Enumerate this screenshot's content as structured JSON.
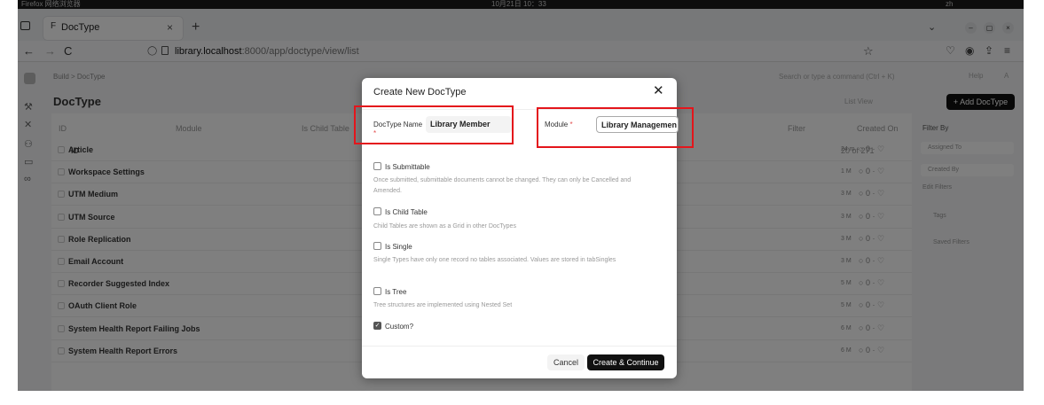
{
  "os": {
    "left_text": "Firefox 网络浏览器",
    "clock": "10月21日 10：33",
    "right_text": "zh"
  },
  "browser": {
    "tab_title": "DocType",
    "tab_close": "×",
    "new_tab": "+",
    "url_host": "library.localhost",
    "url_path": ":8000/app/doctype/view/list",
    "back": "←",
    "forward": "→",
    "reload": "C",
    "dropdown": "⌄",
    "win_min": "–",
    "win_max": "▢",
    "win_close": "×"
  },
  "app": {
    "breadcrumb": "Build > DocType",
    "title": "DocType",
    "search_placeholder": "Search or type a command (Ctrl + K)",
    "help": "Help",
    "avatar": "A",
    "list_view": "List View",
    "add_button": "+ Add DocType",
    "filter": "Filter",
    "sort": "Created On",
    "count": "20 of 271",
    "header_id": "ID",
    "header_module": "Module",
    "header_child": "Is Child Table",
    "col_id": "ID",
    "rows": [
      {
        "name": "Article",
        "time": "24 m",
        "comments": "0"
      },
      {
        "name": "Workspace Settings",
        "time": "1 M",
        "comments": "0"
      },
      {
        "name": "UTM Medium",
        "time": "3 M",
        "comments": "0"
      },
      {
        "name": "UTM Source",
        "time": "3 M",
        "comments": "0"
      },
      {
        "name": "Role Replication",
        "time": "3 M",
        "comments": "0"
      },
      {
        "name": "Email Account",
        "time": "3 M",
        "comments": "0"
      },
      {
        "name": "Recorder Suggested Index",
        "time": "5 M",
        "comments": "0"
      },
      {
        "name": "OAuth Client Role",
        "time": "5 M",
        "comments": "0"
      },
      {
        "name": "System Health Report Failing Jobs",
        "time": "6 M",
        "comments": "0"
      },
      {
        "name": "System Health Report Errors",
        "time": "6 M",
        "comments": "0"
      }
    ],
    "filter_by": "Filter By",
    "assigned_to": "Assigned To",
    "created_by": "Created By",
    "edit_filters": "Edit Filters",
    "tags": "Tags",
    "saved_filters": "Saved Filters"
  },
  "modal": {
    "title": "Create New DocType",
    "close": "✕",
    "doctype_name_label": "DocType Name",
    "doctype_name_value": "Library Member",
    "module_label": "Module",
    "module_value": "Library Managemen",
    "required_mark": "*",
    "options": [
      {
        "label": "Is Submittable",
        "desc": "Once submitted, submittable documents cannot be changed. They can only be Cancelled and Amended.",
        "checked": false
      },
      {
        "label": "Is Child Table",
        "desc": "Child Tables are shown as a Grid in other DocTypes",
        "checked": false
      },
      {
        "label": "Is Single",
        "desc": "Single Types have only one record no tables associated. Values are stored in tabSingles",
        "checked": false
      },
      {
        "label": "Is Tree",
        "desc": "Tree structures are implemented using Nested Set",
        "checked": false
      },
      {
        "label": "Custom?",
        "desc": "",
        "checked": true
      }
    ],
    "cancel": "Cancel",
    "create": "Create & Continue"
  },
  "colors": {
    "highlight": "#e4151b",
    "primary": "#111111"
  }
}
